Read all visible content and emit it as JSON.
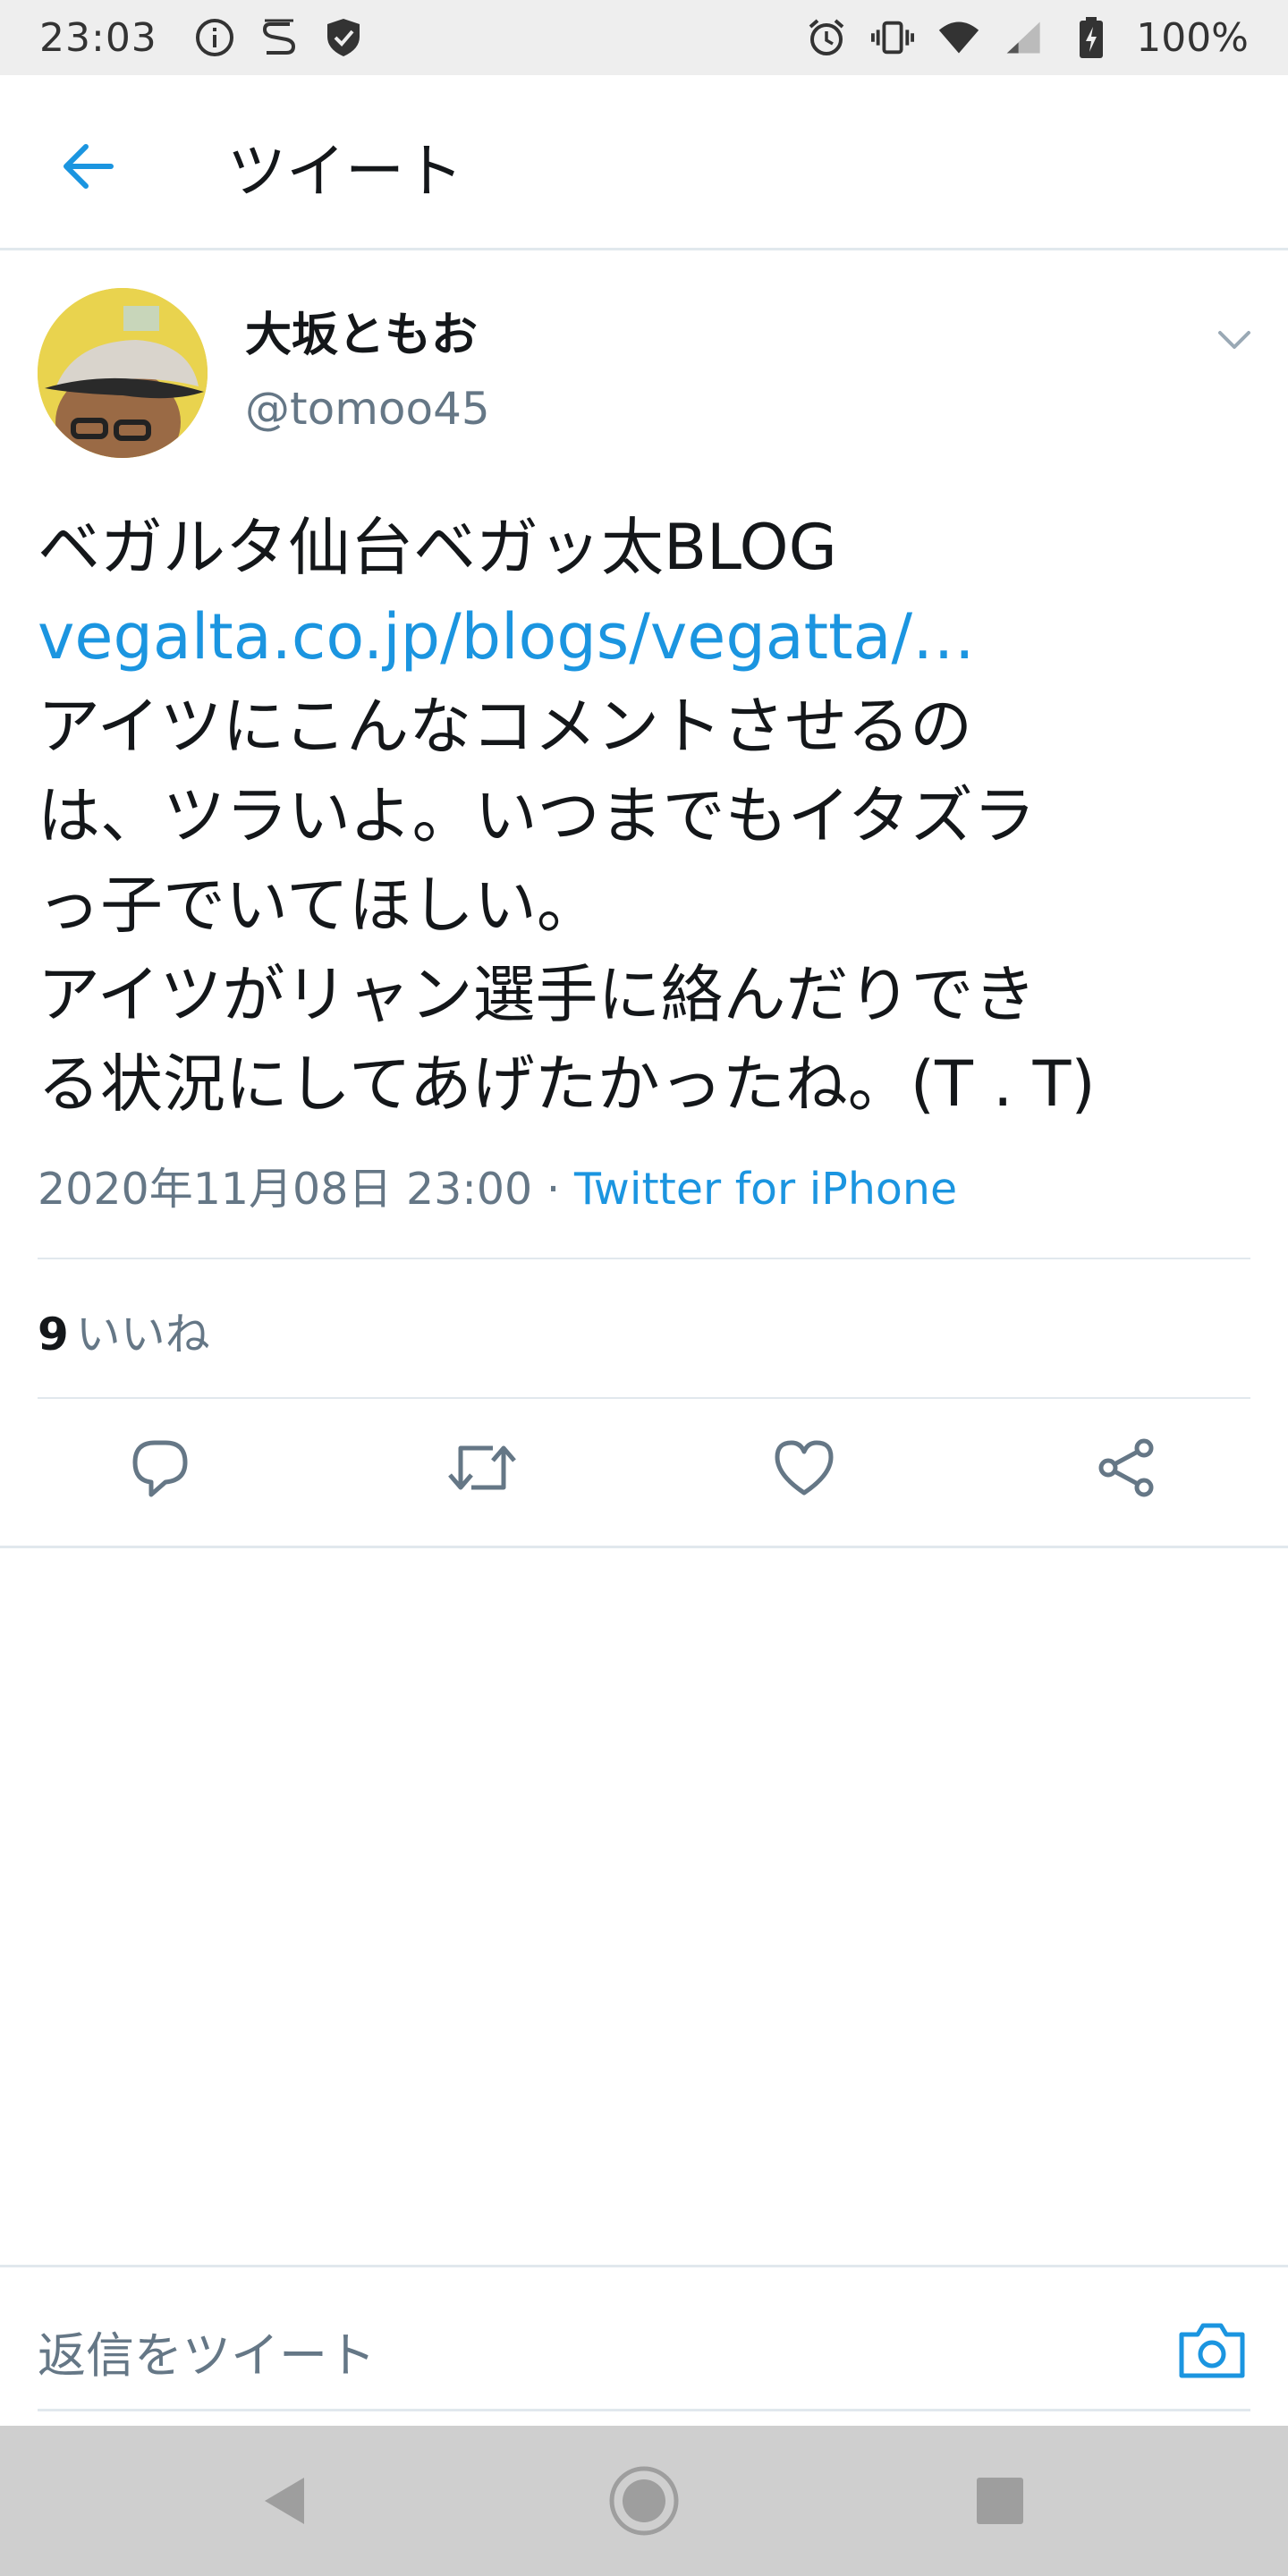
{
  "status_bar": {
    "time": "23:03",
    "battery": "100%",
    "icons": [
      "info-icon",
      "s-logo-icon",
      "shield-icon",
      "alarm-icon",
      "vibrate-icon",
      "wifi-icon",
      "signal-icon",
      "battery-charging-icon"
    ]
  },
  "header": {
    "title": "ツイート",
    "back_icon": "back-arrow-icon"
  },
  "tweet": {
    "author_name": "大坂ともお",
    "author_handle": "@tomoo45",
    "text_lines": [
      "ベガルタ仙台ベガッ太BLOG",
      "vegalta.co.jp/blogs/vegatta/…",
      "アイツにこんなコメントさせるの",
      "は、ツラいよ。いつまでもイタズラ",
      "っ子でいてほしい。",
      "アイツがリャン選手に絡んだりでき",
      "る状況にしてあげたかったね。(T . T)"
    ],
    "timestamp": "2020年11月08日 23:00",
    "separator": " · ",
    "source": "Twitter for iPhone",
    "likes_count": "9",
    "likes_label": "いいね"
  },
  "actions": [
    "reply-icon",
    "retweet-icon",
    "like-icon",
    "share-icon"
  ],
  "reply_bar": {
    "placeholder": "返信をツイート"
  },
  "colors": {
    "accent": "#1b95e0",
    "text": "#14171a",
    "secondary": "#657786",
    "border": "#e1e8ed"
  }
}
